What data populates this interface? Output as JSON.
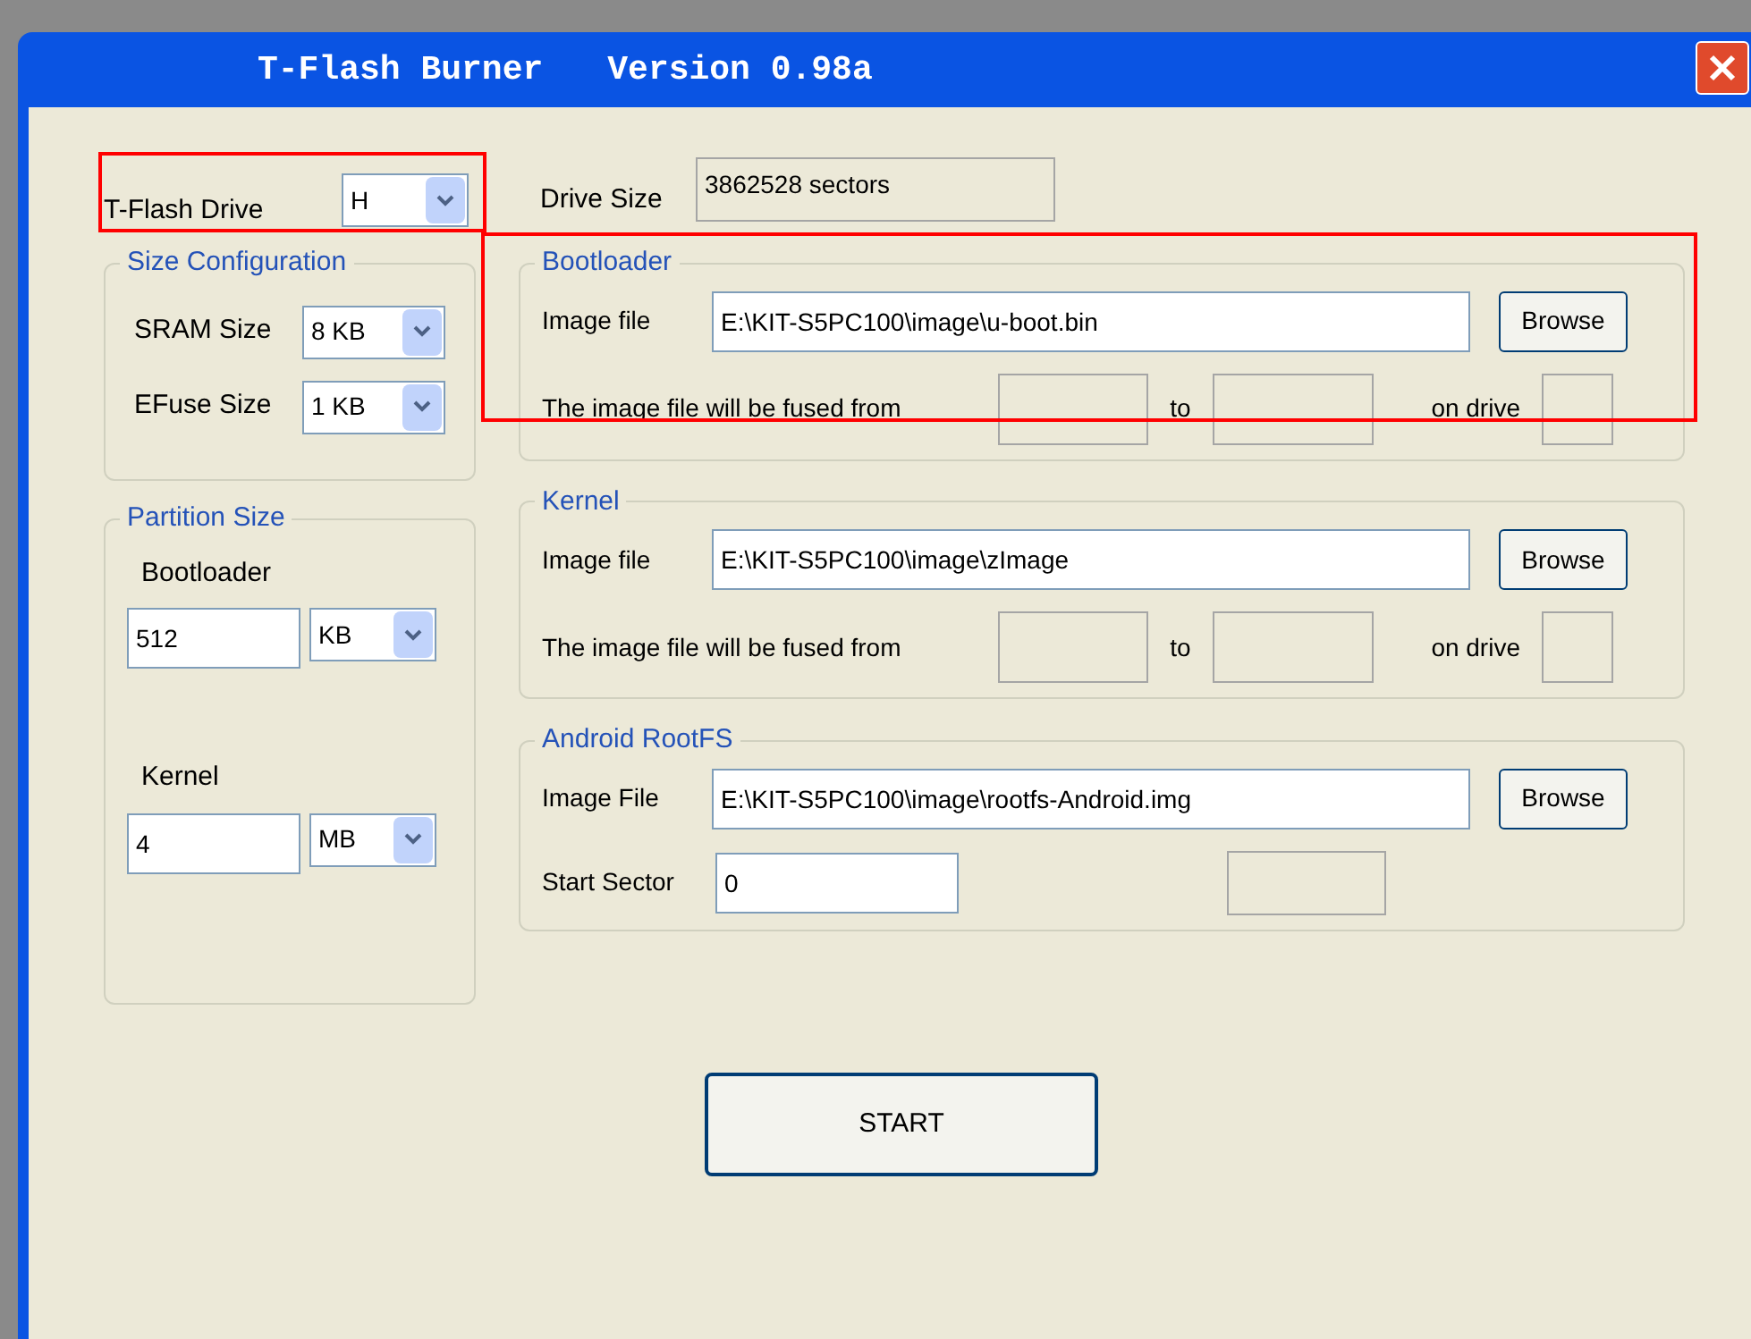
{
  "window": {
    "title": "T-Flash Burner",
    "version": "Version 0.98a"
  },
  "drive": {
    "label": "T-Flash Drive",
    "value": "H"
  },
  "drive_size": {
    "label": "Drive Size",
    "value": "3862528 sectors"
  },
  "size_configuration": {
    "title": "Size Configuration",
    "rows": [
      {
        "label": "SRAM Size",
        "value": "8 KB"
      },
      {
        "label": "EFuse Size",
        "value": "1 KB"
      }
    ]
  },
  "partition_size": {
    "title": "Partition Size",
    "items": [
      {
        "label": "Bootloader",
        "value": "512",
        "unit": "KB"
      },
      {
        "label": "Kernel",
        "value": "4",
        "unit": "MB"
      }
    ]
  },
  "images": [
    {
      "kind": "fused",
      "title": "Bootloader",
      "file_label": "Image file",
      "path": "E:\\KIT-S5PC100\\image\\u-boot.bin",
      "button": "Browse",
      "fused_label": "The image file will be fused from",
      "to_label": "to",
      "drive_label": "on drive"
    },
    {
      "kind": "fused",
      "title": "Kernel",
      "file_label": "Image file",
      "path": "E:\\KIT-S5PC100\\image\\zImage",
      "button": "Browse",
      "fused_label": "The image file will be fused from",
      "to_label": "to",
      "drive_label": "on drive"
    },
    {
      "kind": "sector",
      "title": "Android RootFS",
      "file_label": "Image File",
      "path": "E:\\KIT-S5PC100\\image\\rootfs-Android.img",
      "button": "Browse",
      "sector_label": "Start Sector",
      "sector_value": "0"
    }
  ],
  "start_button": "START"
}
